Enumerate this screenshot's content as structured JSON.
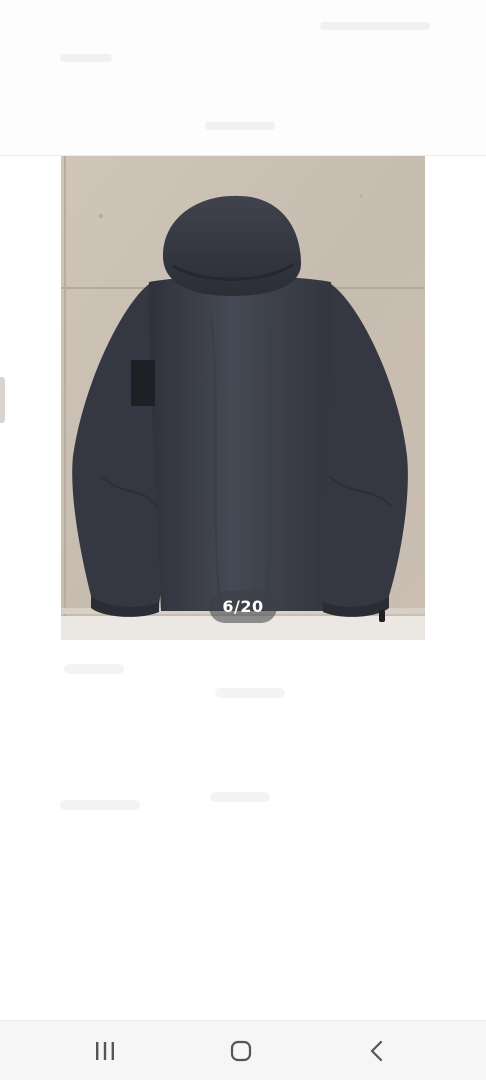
{
  "viewer": {
    "counter": "6/20",
    "image_description_icon": "photo-icon"
  },
  "navbar": {
    "recents_icon": "recents-icon",
    "home_icon": "home-icon",
    "back_icon": "back-icon"
  },
  "colors": {
    "jacket": "#3a3d47",
    "wall": "#c9bfb3",
    "navbar_bg": "#f6f6f6",
    "navbar_icon": "#555555"
  }
}
